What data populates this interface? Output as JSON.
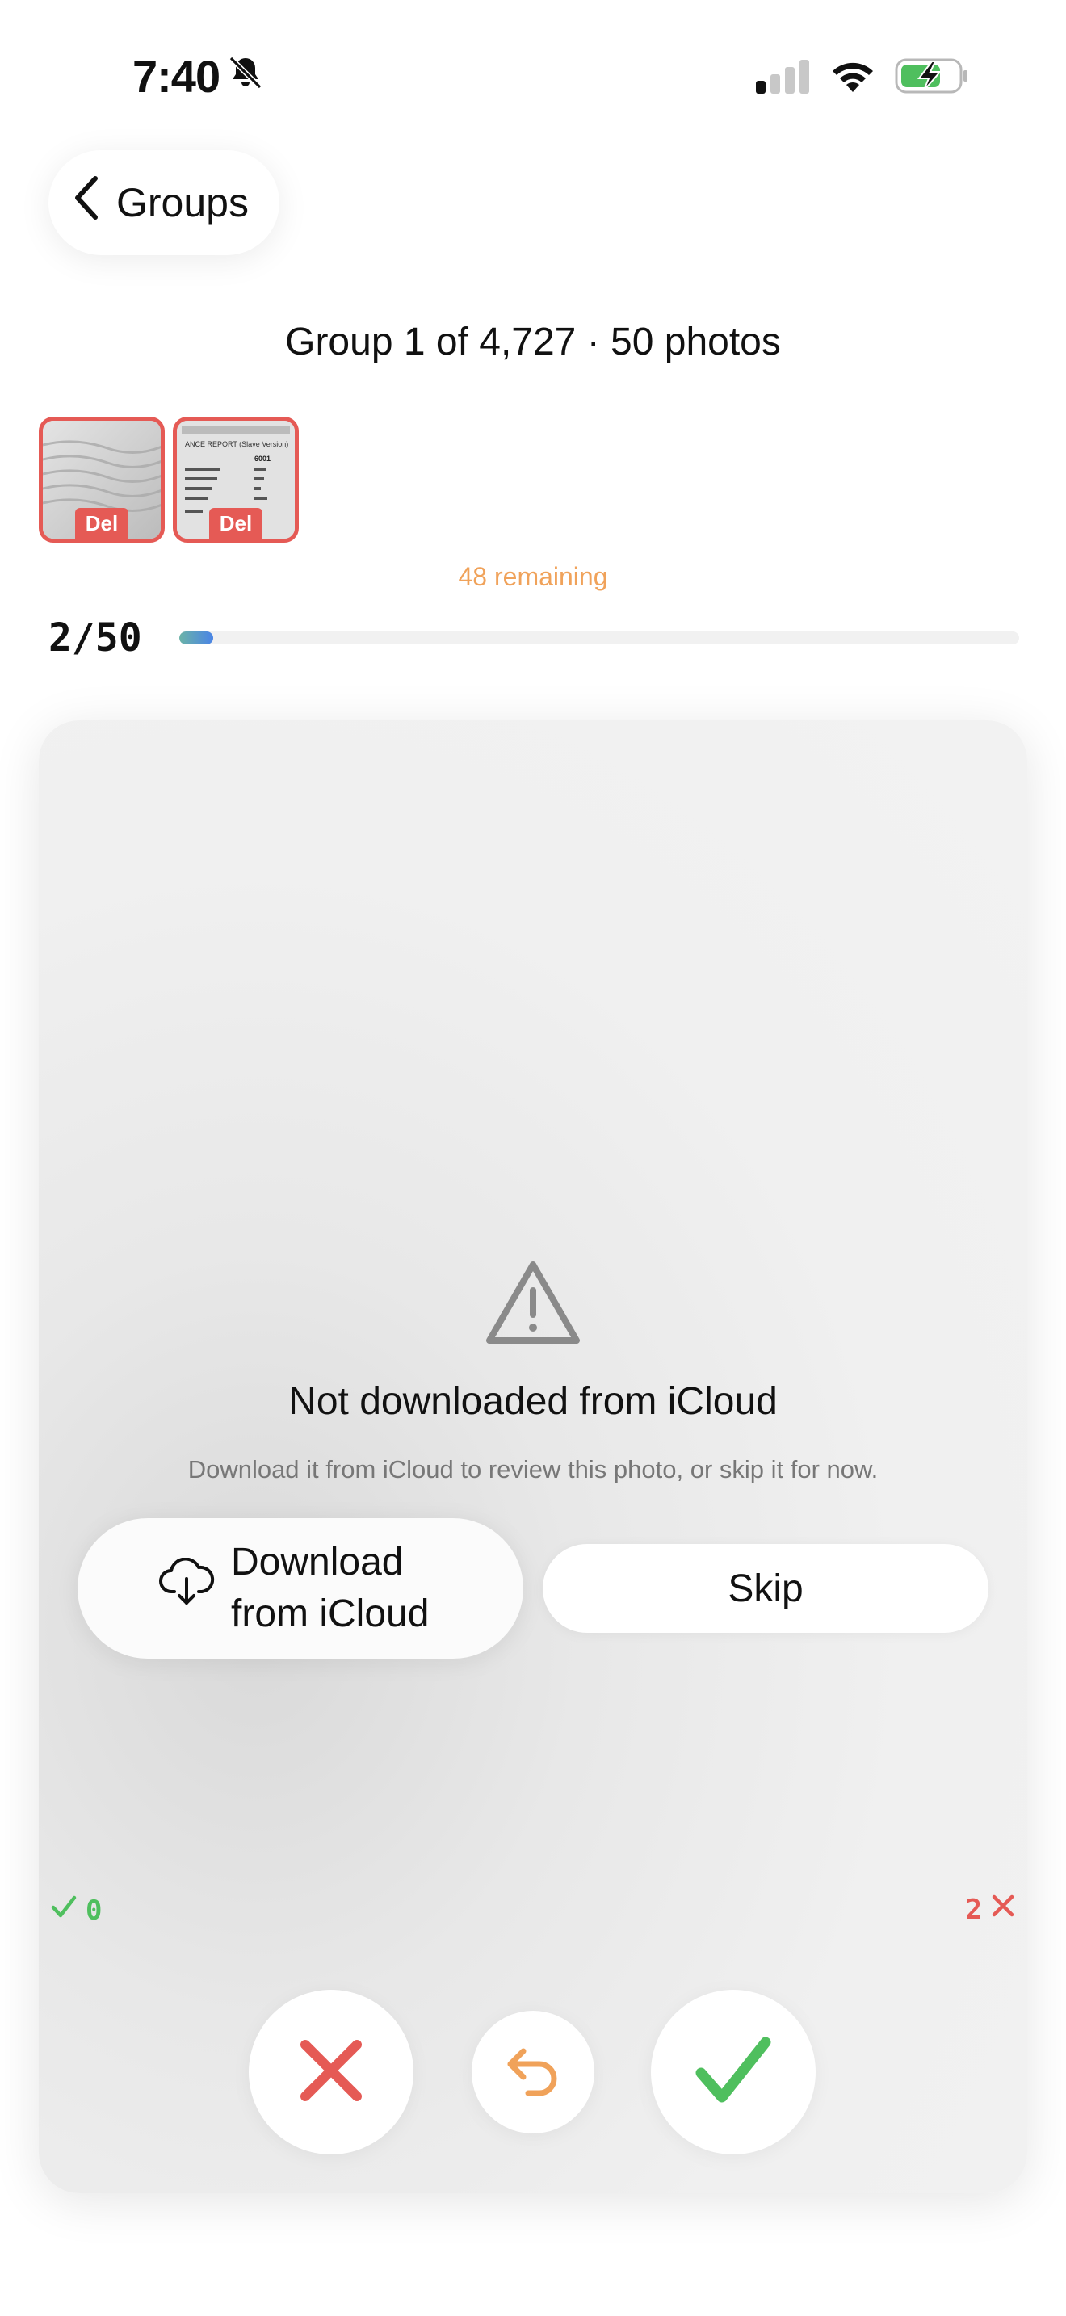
{
  "status_bar": {
    "time": "7:40"
  },
  "nav": {
    "back_label": "Groups"
  },
  "header": {
    "title": "Group 1 of 4,727 · 50 photos"
  },
  "thumbnails": [
    {
      "badge": "Del"
    },
    {
      "badge": "Del",
      "doc_lines": [
        "ANCE REPORT (Slave Version)",
        "6001"
      ]
    }
  ],
  "remaining_label": "48 remaining",
  "progress": {
    "label": "2/50",
    "current": 2,
    "total": 50
  },
  "card": {
    "title": "Not downloaded from iCloud",
    "subtitle": "Download it from iCloud to review this photo, or skip it for now.",
    "download_line1": "Download",
    "download_line2": "from iCloud",
    "skip_label": "Skip"
  },
  "tallies": {
    "kept": "0",
    "deleted": "2"
  },
  "colors": {
    "accent_red": "#e55a55",
    "accent_green": "#4fbf5e",
    "accent_orange": "#f0a25a",
    "progress_blue": "#4a84e6"
  },
  "icons": [
    "bell-slash-icon",
    "signal-icon",
    "wifi-icon",
    "battery-charging-icon",
    "chevron-left-icon",
    "warning-triangle-icon",
    "cloud-download-icon",
    "checkmark-icon",
    "x-icon",
    "undo-arrow-icon"
  ]
}
